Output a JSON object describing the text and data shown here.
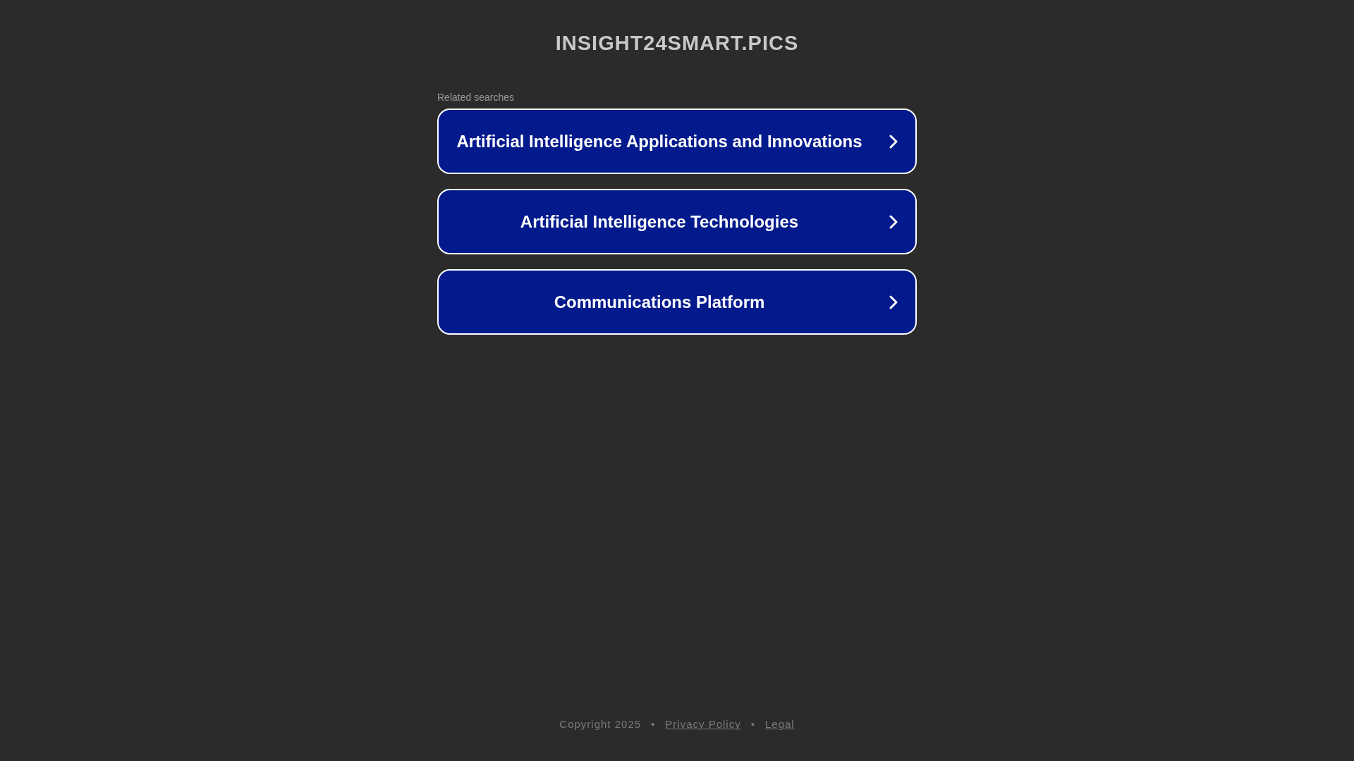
{
  "site_title": "INSIGHT24SMART.PICS",
  "related": {
    "heading": "Related searches",
    "items": [
      {
        "label": "Artificial Intelligence Applications and Innovations"
      },
      {
        "label": "Artificial Intelligence Technologies"
      },
      {
        "label": "Communications Platform"
      }
    ]
  },
  "footer": {
    "copyright": "Copyright 2025",
    "separator": "•",
    "links": [
      "Privacy Policy",
      "Legal"
    ]
  }
}
